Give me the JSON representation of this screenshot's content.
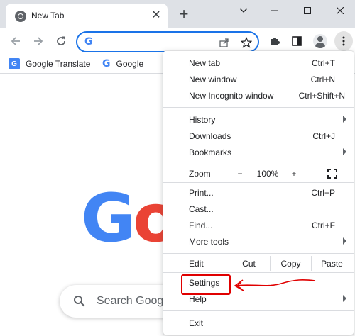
{
  "window": {
    "tab_title": "New Tab",
    "tab_close": "✕",
    "new_tab": "+"
  },
  "bookmarks": [
    {
      "label": "Google Translate",
      "icon": "translate-icon"
    },
    {
      "label": "Google",
      "icon": "google-g-icon"
    }
  ],
  "omnibox": {
    "value": "",
    "icon": "google-g-icon"
  },
  "page": {
    "logo_letters": [
      "G",
      "o"
    ],
    "search_placeholder": "Search Googl"
  },
  "menu": {
    "new_tab": {
      "label": "New tab",
      "shortcut": "Ctrl+T"
    },
    "new_window": {
      "label": "New window",
      "shortcut": "Ctrl+N"
    },
    "new_incognito": {
      "label": "New Incognito window",
      "shortcut": "Ctrl+Shift+N"
    },
    "history": {
      "label": "History"
    },
    "downloads": {
      "label": "Downloads",
      "shortcut": "Ctrl+J"
    },
    "bookmarks": {
      "label": "Bookmarks"
    },
    "zoom": {
      "label": "Zoom",
      "minus": "−",
      "value": "100%",
      "plus": "+"
    },
    "print": {
      "label": "Print...",
      "shortcut": "Ctrl+P"
    },
    "cast": {
      "label": "Cast..."
    },
    "find": {
      "label": "Find...",
      "shortcut": "Ctrl+F"
    },
    "more_tools": {
      "label": "More tools"
    },
    "edit": {
      "label": "Edit",
      "cut": "Cut",
      "copy": "Copy",
      "paste": "Paste"
    },
    "settings": {
      "label": "Settings"
    },
    "help": {
      "label": "Help"
    },
    "exit": {
      "label": "Exit"
    }
  },
  "colors": {
    "accent": "#1a73e8",
    "annotation": "#e00000"
  }
}
